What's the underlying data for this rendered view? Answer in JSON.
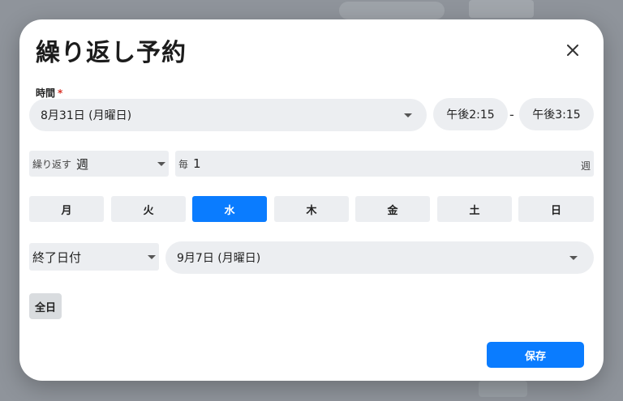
{
  "dialog": {
    "title": "繰り返し予約",
    "time_label": "時間",
    "required_mark": "*",
    "start_date": "8月31日 (月曜日)",
    "start_time": "午後2:15",
    "separator": "-",
    "end_time": "午後3:15",
    "repeat": {
      "label": "繰り返す",
      "value": "週",
      "every_prefix": "毎",
      "interval": "1",
      "unit": "週"
    },
    "weekdays": [
      {
        "label": "月",
        "selected": false
      },
      {
        "label": "火",
        "selected": false
      },
      {
        "label": "水",
        "selected": true
      },
      {
        "label": "木",
        "selected": false
      },
      {
        "label": "金",
        "selected": false
      },
      {
        "label": "土",
        "selected": false
      },
      {
        "label": "日",
        "selected": false
      }
    ],
    "end_type": "終了日付",
    "end_date": "9月7日 (月曜日)",
    "all_day_label": "全日",
    "save_label": "保存"
  },
  "colors": {
    "accent": "#0a7cff",
    "field_bg": "#eceef1",
    "required": "#d93025"
  },
  "icons": {
    "close": "close-icon",
    "dropdown": "chevron-down-icon"
  }
}
